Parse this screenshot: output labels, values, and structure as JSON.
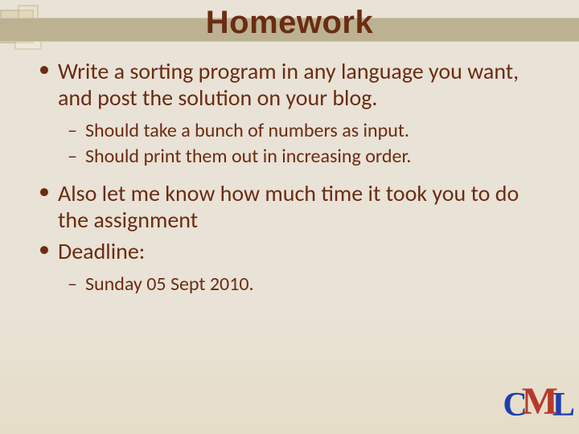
{
  "title": "Homework",
  "bullets": [
    {
      "text": "Write a sorting program in any language you want, and post the solution on your blog.",
      "sub": [
        "Should take a bunch of numbers as input.",
        "Should print them out in increasing order."
      ]
    },
    {
      "text": "Also let me know how much time it took you to do the assignment",
      "sub": []
    },
    {
      "text": "Deadline:",
      "sub": [
        "Sunday 05 Sept 2010."
      ]
    }
  ],
  "logo": {
    "c": "C",
    "m": "M",
    "l": "L"
  }
}
